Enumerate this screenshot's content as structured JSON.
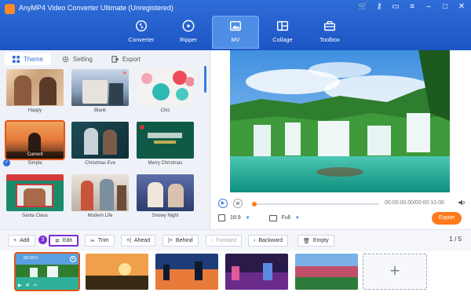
{
  "app": {
    "title": "AnyMP4 Video Converter Ultimate (Unregistered)"
  },
  "nav": [
    "Converter",
    "Ripper",
    "MV",
    "Collage",
    "Toolbox"
  ],
  "subtabs": [
    "Theme",
    "Setting",
    "Export"
  ],
  "themes": [
    "Happy",
    "Blank",
    "Chic",
    "Simple",
    "Christmas Eve",
    "Merry Christmas",
    "Santa Claus",
    "Modern Life",
    "Snowy Night"
  ],
  "current_tag": "Current",
  "player": {
    "timecode": "00:00:00.00/00:00:10.00",
    "ratio": "16:9",
    "mode": "Full",
    "export_label": "Export",
    "progress": 0
  },
  "toolbar": {
    "add": "Add",
    "edit": "Edit",
    "trim": "Trim",
    "ahead": "Ahead",
    "behind": "Behind",
    "forward": "Forward",
    "backward": "Backward",
    "empty": "Empty",
    "step": "3"
  },
  "pager": "1 / 5",
  "clip_time": "00:00:1",
  "colors": {
    "accent": "#2f6dd8",
    "export": "#ff7a1a",
    "highlight": "#7b2cd6",
    "selected": "#e0561b"
  }
}
